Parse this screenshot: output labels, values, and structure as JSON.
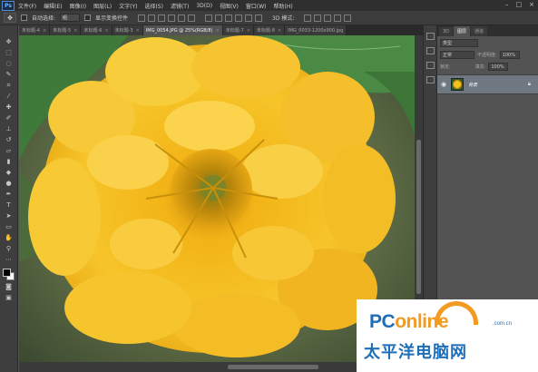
{
  "app": {
    "logo": "Ps"
  },
  "menu": [
    "文件(F)",
    "编辑(E)",
    "图像(I)",
    "图层(L)",
    "文字(Y)",
    "选择(S)",
    "滤镜(T)",
    "3D(D)",
    "视图(V)",
    "窗口(W)",
    "帮助(H)"
  ],
  "window_buttons": [
    "–",
    "□",
    "×"
  ],
  "options": {
    "auto_select_label": "自动选择:",
    "auto_select_value": "组",
    "show_transform_label": "显示变换控件",
    "mode_3d_label": "3D 模式:"
  },
  "tabs": [
    {
      "label": "未标题-4",
      "active": false
    },
    {
      "label": "未标题-5",
      "active": false
    },
    {
      "label": "未标题-6",
      "active": false
    },
    {
      "label": "未标题-3",
      "active": false
    },
    {
      "label": "IMG_0054.JPG @ 25%(RGB/8)",
      "active": true
    },
    {
      "label": "未标题-7",
      "active": false
    },
    {
      "label": "未标题-8",
      "active": false
    },
    {
      "label": "IMG_0033-1200x900.jpg",
      "active": false
    }
  ],
  "panel": {
    "tabs": [
      "3D",
      "图层",
      "通道"
    ],
    "kind_label": "类型",
    "blend_mode": "正常",
    "opacity_label": "不透明度:",
    "opacity_value": "100%",
    "lock_label": "锁定:",
    "fill_label": "填充:",
    "fill_value": "100%",
    "layer_name": "背景"
  },
  "watermark": {
    "brand_a": "PC",
    "brand_b": "online",
    "domain": ".com.cn",
    "cn": "太平洋电脑网"
  },
  "colors": {
    "flower": "#f4b51c",
    "leaf": "#3f7a3a",
    "brand_blue": "#1f6eb8",
    "brand_orange": "#f39a21"
  }
}
